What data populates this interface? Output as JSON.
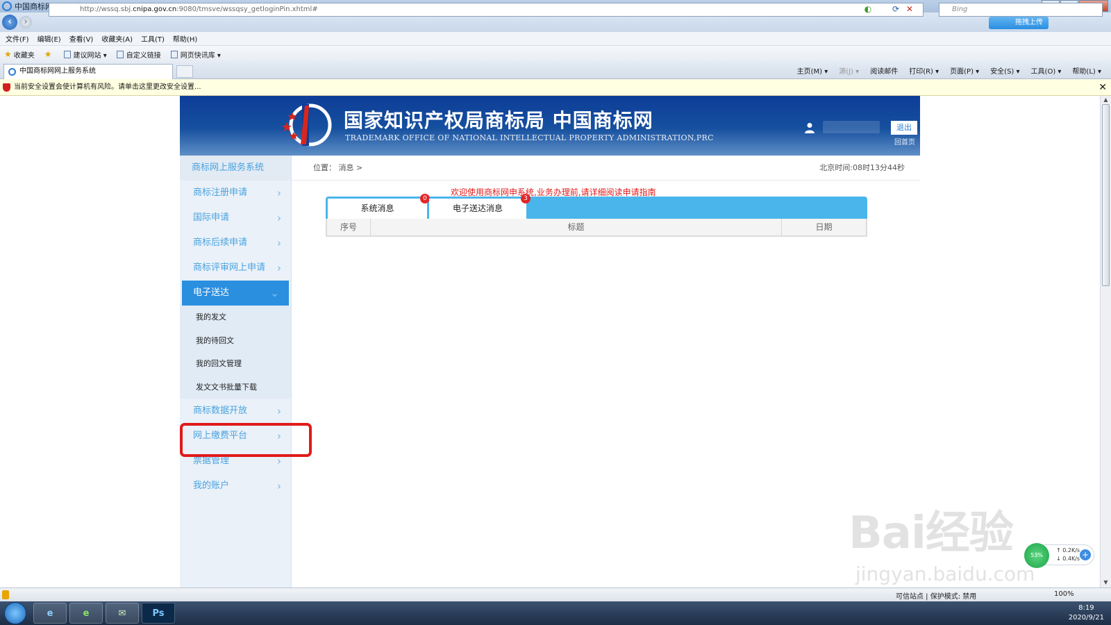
{
  "window": {
    "title": "中国商标网网上服务系统 - Windows Internet Explorer",
    "url_prefix": "http://wssq.sbj.",
    "url_host": "cnipa.gov.cn",
    "url_suffix": ":9080/tmsve/wssqsy_getloginPin.xhtml#",
    "search_placeholder": "Bing",
    "upload_label": "拖拽上传",
    "minimize": "–",
    "maximize": "□",
    "close": "✕"
  },
  "menu": [
    "文件(F)",
    "编辑(E)",
    "查看(V)",
    "收藏夹(A)",
    "工具(T)",
    "帮助(H)"
  ],
  "favorites": {
    "label": "收藏夹",
    "items": [
      "建议网站 ▾",
      "自定义链接",
      "网页快讯库 ▾"
    ]
  },
  "browser_tab": {
    "label": "中国商标网网上服务系统"
  },
  "command_bar": [
    "主页(M) ▾",
    "源(J) ▾",
    "阅读邮件",
    "打印(R) ▾",
    "页面(P) ▾",
    "安全(S) ▾",
    "工具(O) ▾",
    "帮助(L) ▾"
  ],
  "infobar": {
    "text": "当前安全设置会使计算机有风险。请单击这里更改安全设置...",
    "close": "✕"
  },
  "banner": {
    "title_cn": "国家知识产权局商标局 中国商标网",
    "title_en": "TRADEMARK OFFICE OF NATIONAL INTELLECTUAL PROPERTY ADMINISTRATION,PRC",
    "logout": "退出",
    "home": "回首页"
  },
  "sidebar": {
    "title": "商标网上服务系统",
    "chevron": "›",
    "items": [
      {
        "label": "商标注册申请"
      },
      {
        "label": "国际申请"
      },
      {
        "label": "商标后续申请"
      },
      {
        "label": "商标评审网上申请"
      },
      {
        "label": "电子送达",
        "active": true
      }
    ],
    "subitems": [
      "我的发文",
      "我的待回文",
      "我的回文管理",
      "发文文书批量下载"
    ],
    "items_after": [
      {
        "label": "商标数据开放"
      },
      {
        "label": "网上缴费平台"
      },
      {
        "label": "票据管理"
      },
      {
        "label": "我的账户"
      }
    ]
  },
  "breadcrumb": "位置： 消息 >",
  "clock": "北京时间:08时13分44秒",
  "welcome": "欢迎使用商标网申系统,业务办理前,请详细阅读申请指南",
  "message_tabs": [
    {
      "label": "系统消息",
      "badge": "0"
    },
    {
      "label": "电子送达消息",
      "badge": "3"
    }
  ],
  "table": {
    "columns": [
      "序号",
      "标题",
      "日期"
    ]
  },
  "watermark": {
    "text": "Bai经验",
    "url": "jingyan.baidu.com"
  },
  "speed_widget": {
    "percent": "53%",
    "up": "↑ 0.2K/s",
    "down": "↓ 0.4K/s",
    "plus": "+"
  },
  "statusbar": {
    "zone": "可信站点 | 保护模式: 禁用",
    "zoom": "100%"
  },
  "taskbar": {
    "apps": [
      {
        "name": "ie",
        "label": "e"
      },
      {
        "name": "browser",
        "label": "e"
      },
      {
        "name": "wechat",
        "label": "✉"
      },
      {
        "name": "photoshop",
        "label": "Ps"
      }
    ],
    "time": "8:19",
    "date": "2020/9/21"
  },
  "colors": {
    "accent": "#2b8fe0",
    "tab_bar": "#4ab5ea",
    "highlight": "#e11a1a",
    "banner": "#0d3d98"
  }
}
